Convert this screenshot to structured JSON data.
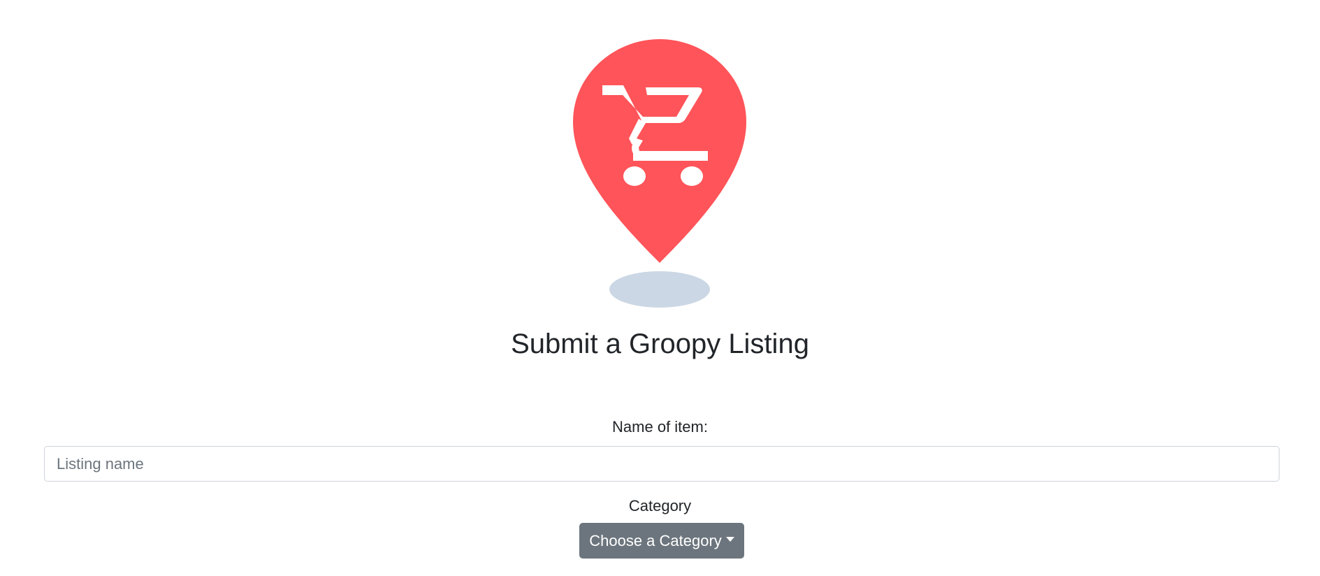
{
  "colors": {
    "pin": "#ff5459",
    "shadow": "#cbd7e4",
    "button": "#6c757d",
    "text": "#212529"
  },
  "logo": {
    "icon": "shopping-cart-map-pin-icon"
  },
  "header": {
    "title": "Submit a Groopy Listing"
  },
  "form": {
    "name_label": "Name of item:",
    "name_placeholder": "Listing name",
    "name_value": "",
    "category_label": "Category",
    "category_button": "Choose a Category",
    "category_button_icon": "caret-down-icon"
  }
}
